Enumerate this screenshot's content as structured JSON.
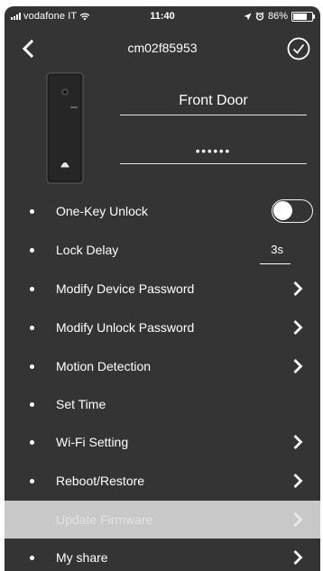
{
  "status_bar": {
    "carrier": "vodafone IT",
    "time": "11:40",
    "battery": "86%",
    "battery_level": 0.86
  },
  "nav": {
    "title": "cm02f85953",
    "back_icon": "chevron-left-icon",
    "confirm_icon": "check-circle-icon"
  },
  "device": {
    "name": "Front Door",
    "password_masked": "••••••"
  },
  "settings": {
    "one_key_unlock": {
      "label": "One-Key Unlock",
      "enabled": false
    },
    "lock_delay": {
      "label": "Lock Delay",
      "value": "3s"
    },
    "modify_device_password": {
      "label": "Modify Device Password"
    },
    "modify_unlock_password": {
      "label": "Modify Unlock Password"
    },
    "motion_detection": {
      "label": "Motion Detection"
    },
    "set_time": {
      "label": "Set Time"
    },
    "wifi_setting": {
      "label": "Wi-Fi Setting"
    },
    "reboot_restore": {
      "label": "Reboot/Restore"
    },
    "update_firmware": {
      "label": "Update Firmware",
      "disabled": true
    },
    "my_share": {
      "label": "My share"
    }
  },
  "colors": {
    "background": "#343434",
    "text": "#ffffff",
    "disabled_row": "#c8c8c8"
  }
}
